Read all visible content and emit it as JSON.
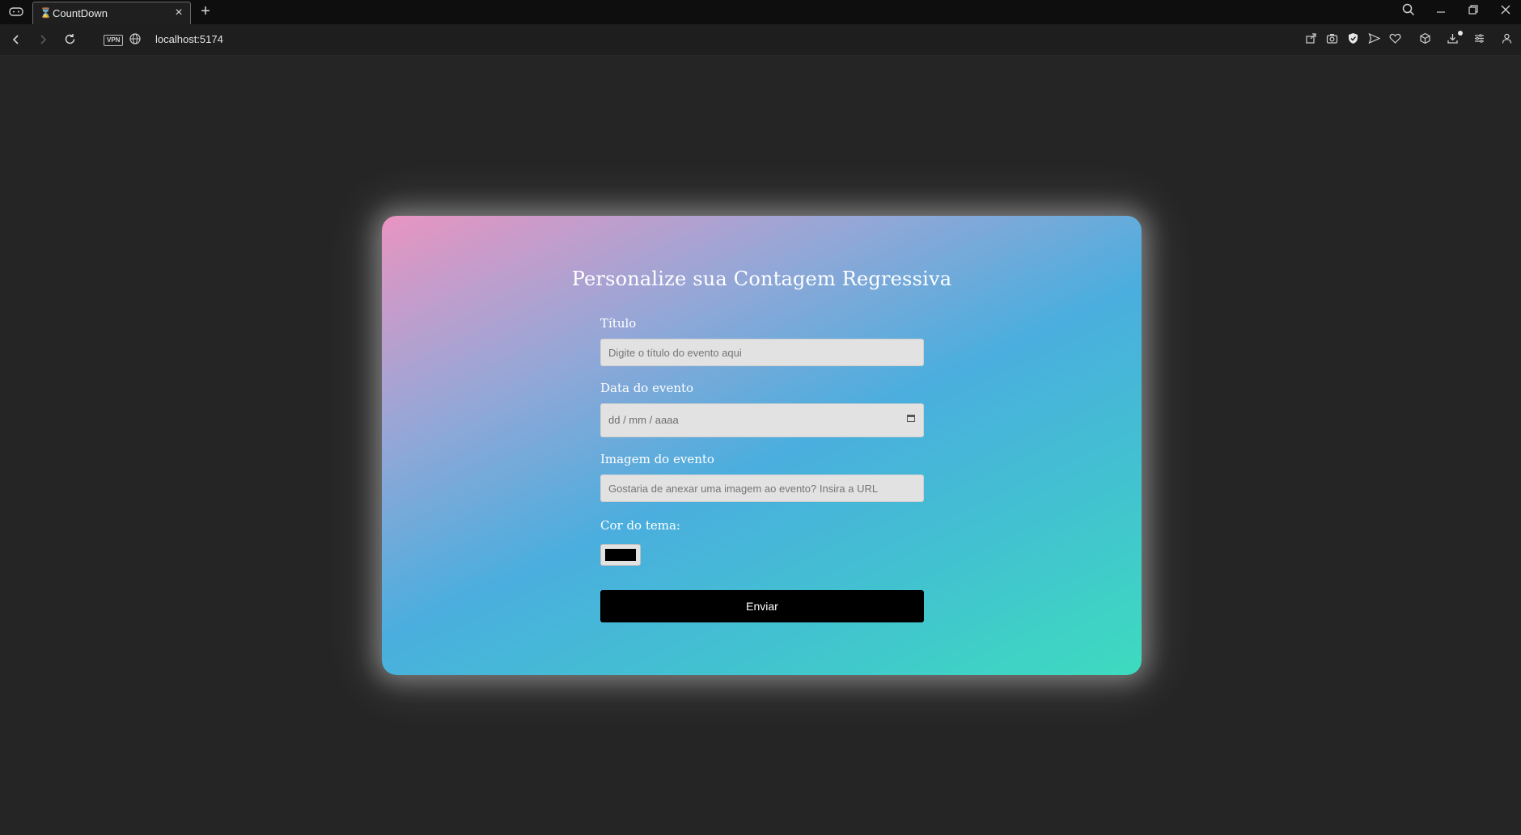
{
  "browser": {
    "tab_title": "CountDown",
    "tab_favicon": "hourglass-icon",
    "address": "localhost:5174",
    "vpn_label": "VPN"
  },
  "form": {
    "heading": "Personalize sua Contagem Regressiva",
    "title_label": "Título",
    "title_placeholder": "Digite o título do evento aqui",
    "date_label": "Data do evento",
    "date_placeholder": "dd / mm / aaaa",
    "image_label": "Imagem do evento",
    "image_placeholder": "Gostaria de anexar uma imagem ao evento? Insira a URL",
    "color_label": "Cor do tema:",
    "color_value": "#000000",
    "submit_label": "Enviar"
  },
  "colors": {
    "gradient_start": "#e994c1",
    "gradient_mid": "#4aaede",
    "gradient_end": "#3ddbbf",
    "page_background": "#252525",
    "button_background": "#000000"
  }
}
